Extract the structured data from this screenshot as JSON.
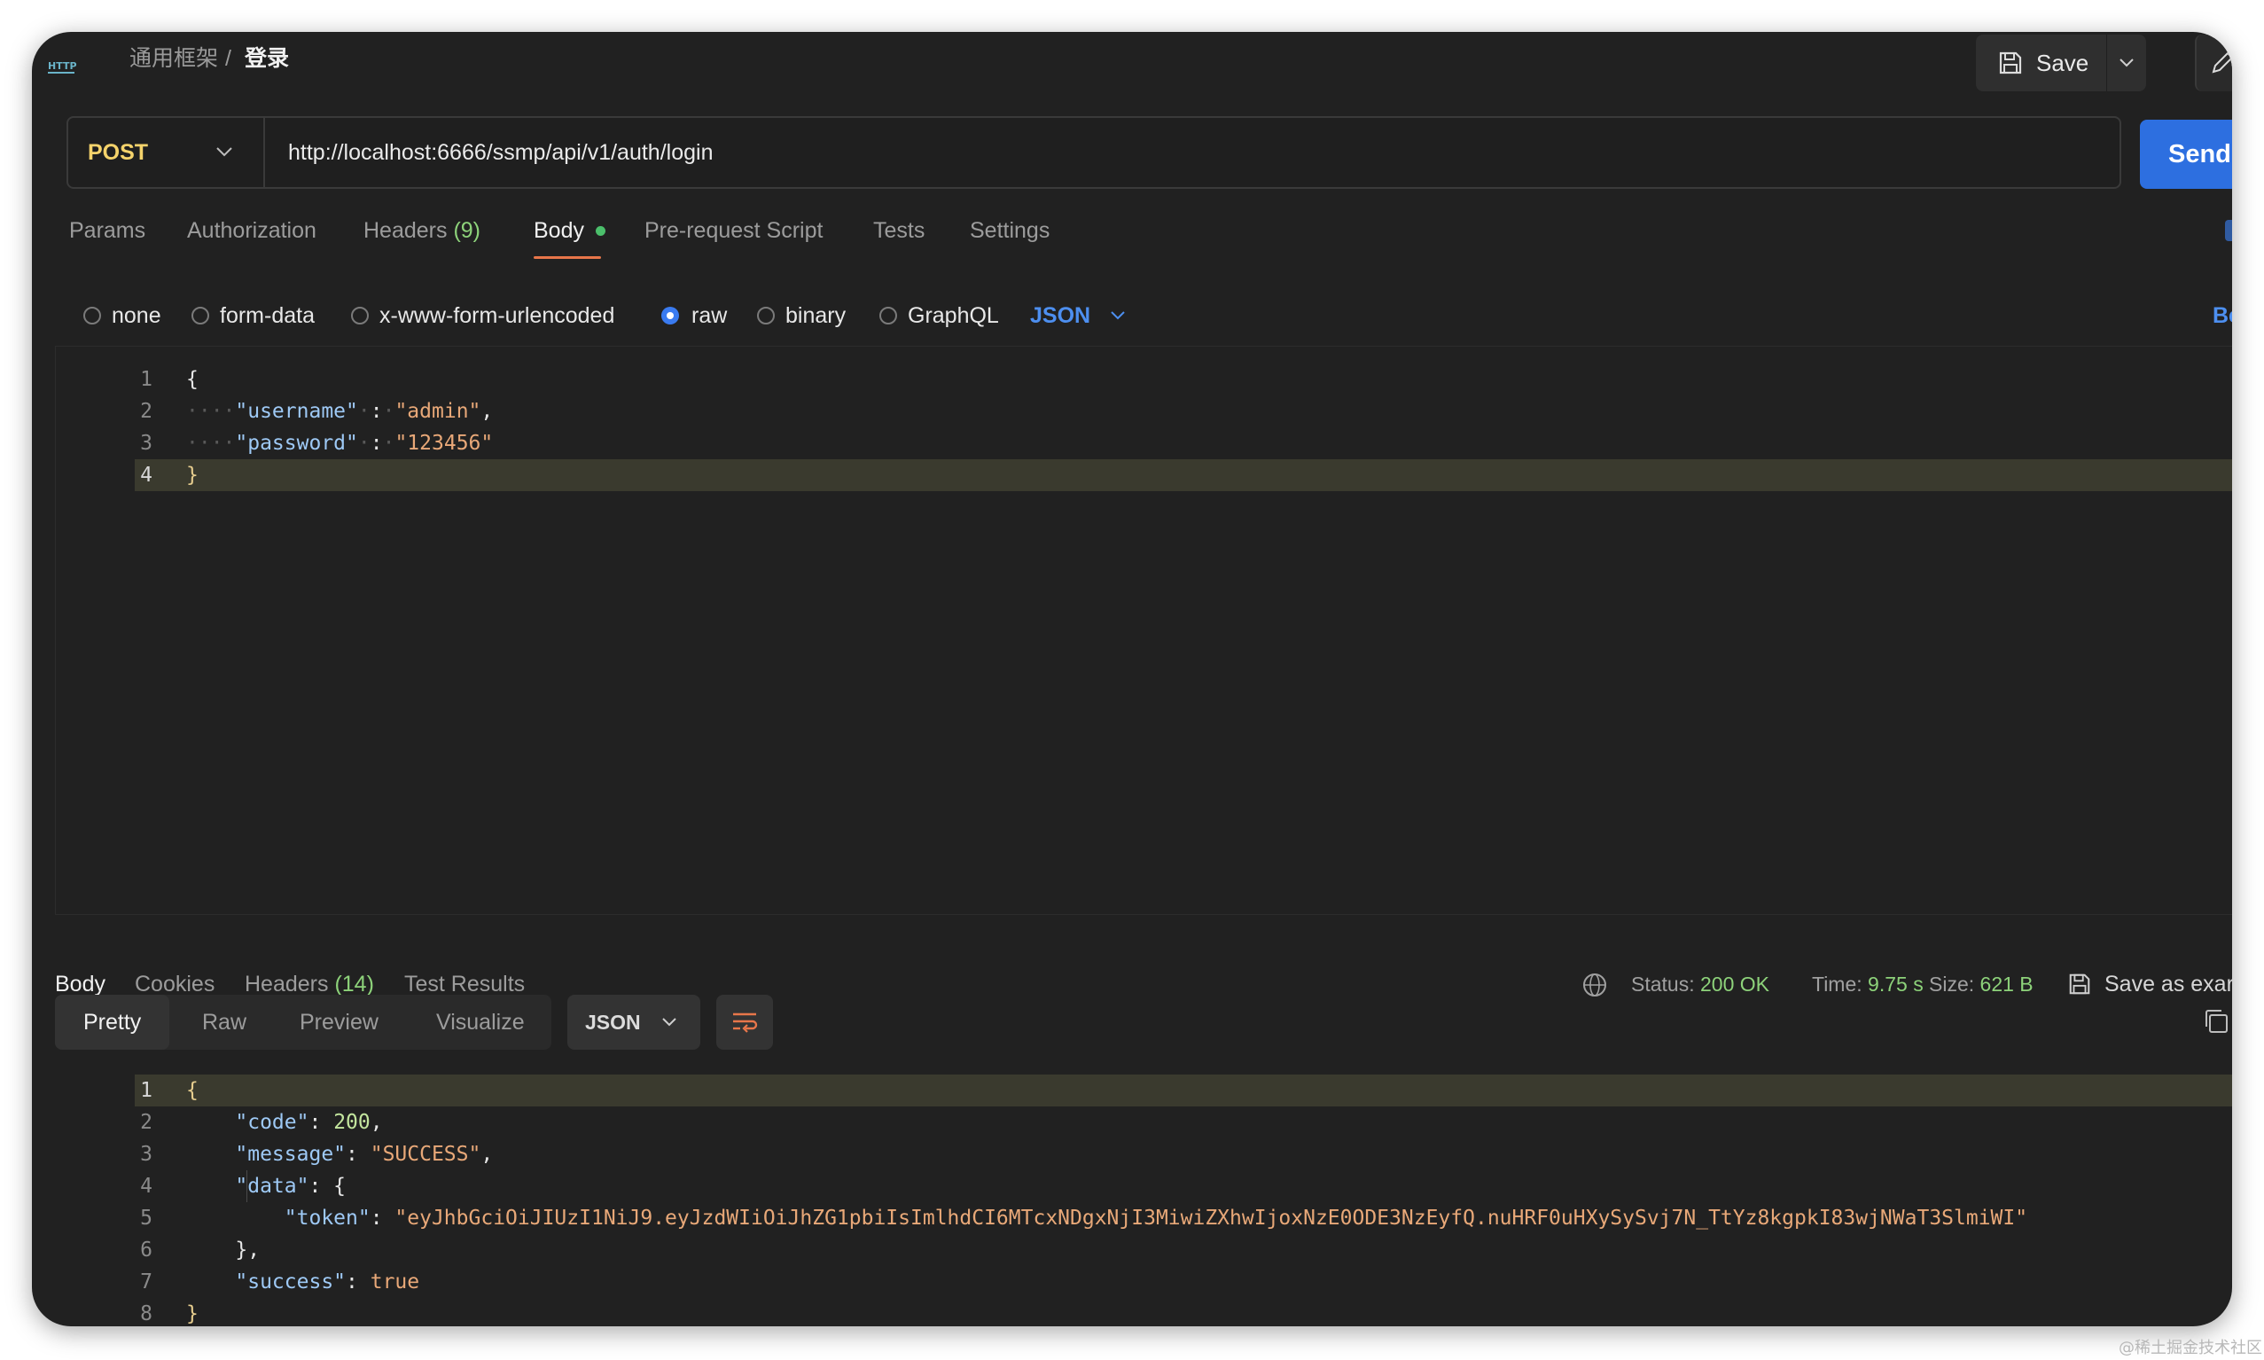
{
  "breadcrumb": {
    "collection": "通用框架",
    "separator": "/",
    "request_name": "登录",
    "icon_label": "HTTP"
  },
  "toolbar": {
    "save_label": "Save"
  },
  "request": {
    "method": "POST",
    "url": "http://localhost:6666/ssmp/api/v1/auth/login",
    "send_label": "Send"
  },
  "request_tabs": [
    {
      "label": "Params"
    },
    {
      "label": "Authorization"
    },
    {
      "label": "Headers",
      "count": "(9)"
    },
    {
      "label": "Body"
    },
    {
      "label": "Pre-request Script"
    },
    {
      "label": "Tests"
    },
    {
      "label": "Settings"
    }
  ],
  "body_modes": {
    "options": [
      "none",
      "form-data",
      "x-www-form-urlencoded",
      "raw",
      "binary",
      "GraphQL"
    ],
    "selected": "raw",
    "language": "JSON",
    "right_cut_label": "Be"
  },
  "request_body": {
    "line_numbers": [
      "1",
      "2",
      "3",
      "4"
    ],
    "lines": {
      "l1": "{",
      "l2_key": "\"username\"",
      "l2_val": "\"admin\"",
      "l3_key": "\"password\"",
      "l3_val": "\"123456\"",
      "l4": "}"
    }
  },
  "response_tabs": [
    {
      "label": "Body"
    },
    {
      "label": "Cookies"
    },
    {
      "label": "Headers",
      "count": "(14)"
    },
    {
      "label": "Test Results"
    }
  ],
  "response_meta": {
    "status_label": "Status:",
    "status_value": "200 OK",
    "time_label": "Time:",
    "time_value": "9.75 s",
    "size_label": "Size:",
    "size_value": "621 B",
    "save_example_label": "Save as exar"
  },
  "response_view": {
    "modes": [
      "Pretty",
      "Raw",
      "Preview",
      "Visualize"
    ],
    "selected": "Pretty",
    "format": "JSON"
  },
  "response_body": {
    "line_numbers": [
      "1",
      "2",
      "3",
      "4",
      "5",
      "6",
      "7",
      "8"
    ],
    "lines": {
      "l1": "{",
      "code_key": "\"code\"",
      "code_val": "200",
      "message_key": "\"message\"",
      "message_val": "\"SUCCESS\"",
      "data_key": "\"data\"",
      "token_key": "\"token\"",
      "token_val": "\"eyJhbGciOiJIUzI1NiJ9.eyJzdWIiOiJhZG1pbiIsImlhdCI6MTcxNDgxNjI3MiwiZXhwIjoxNzE0ODE3NzEyfQ.nuHRF0uHXySySvj7N_TtYz8kgpkI83wjNWaT3SlmiWI\"",
      "close_data": "},",
      "success_key": "\"success\"",
      "success_val": "true",
      "l8": "}"
    }
  },
  "watermark": "@稀土掘金技术社区",
  "colors": {
    "accent_underline": "#e8764a",
    "send_button": "#2d6fe0",
    "status_green": "#8dd27a",
    "method_yellow": "#f5d36b"
  }
}
